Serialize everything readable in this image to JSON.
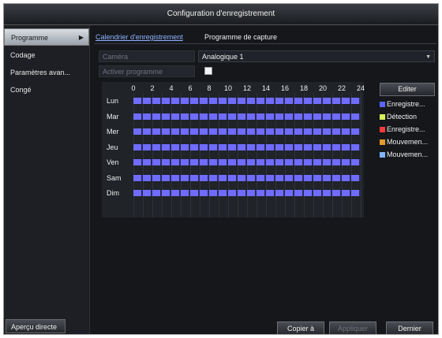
{
  "window": {
    "title": "Configuration d'enregistrement"
  },
  "sidebar": {
    "items": [
      {
        "label": "Programme",
        "active": true
      },
      {
        "label": "Codage",
        "active": false
      },
      {
        "label": "Paramètres avan...",
        "active": false
      },
      {
        "label": "Congé",
        "active": false
      }
    ],
    "preview_label": "Aperçu directe"
  },
  "tabs": [
    {
      "label": "Calendrier d'enregistrement",
      "active": true
    },
    {
      "label": "Programme de capture",
      "active": false
    }
  ],
  "form": {
    "camera_label": "Caméra",
    "camera_value": "Analogique 1",
    "enable_label": "Activer programme",
    "enable_checked": true
  },
  "schedule": {
    "hours": [
      "0",
      "2",
      "4",
      "6",
      "8",
      "10",
      "12",
      "14",
      "16",
      "18",
      "20",
      "22",
      "24"
    ],
    "days": [
      "Lun",
      "Mar",
      "Mer",
      "Jeu",
      "Ven",
      "Sam",
      "Dim"
    ],
    "recorded_from_hour": 0,
    "recorded_to_hour": 24,
    "bar_color": "#6f6cff"
  },
  "edit_label": "Editer",
  "legend": [
    {
      "label": "Enregistre...",
      "color": "#5a66ff",
      "icon": "swatch-normal"
    },
    {
      "label": "Détection",
      "color": "#d7f05a",
      "icon": "swatch-motion"
    },
    {
      "label": "Enregistre...",
      "color": "#ff3b3b",
      "icon": "swatch-alarm"
    },
    {
      "label": "Mouvemen...",
      "color": "#e39a2a",
      "icon": "swatch-motion-alarm"
    },
    {
      "label": "Mouvemen...",
      "color": "#7fb6ff",
      "icon": "swatch-motion-or-alarm"
    }
  ],
  "buttons": {
    "copy": "Copier à",
    "apply": "Appliquer",
    "back": "Dernier"
  },
  "colors": {
    "accent": "#8fb4ff",
    "background": "#15171b"
  }
}
